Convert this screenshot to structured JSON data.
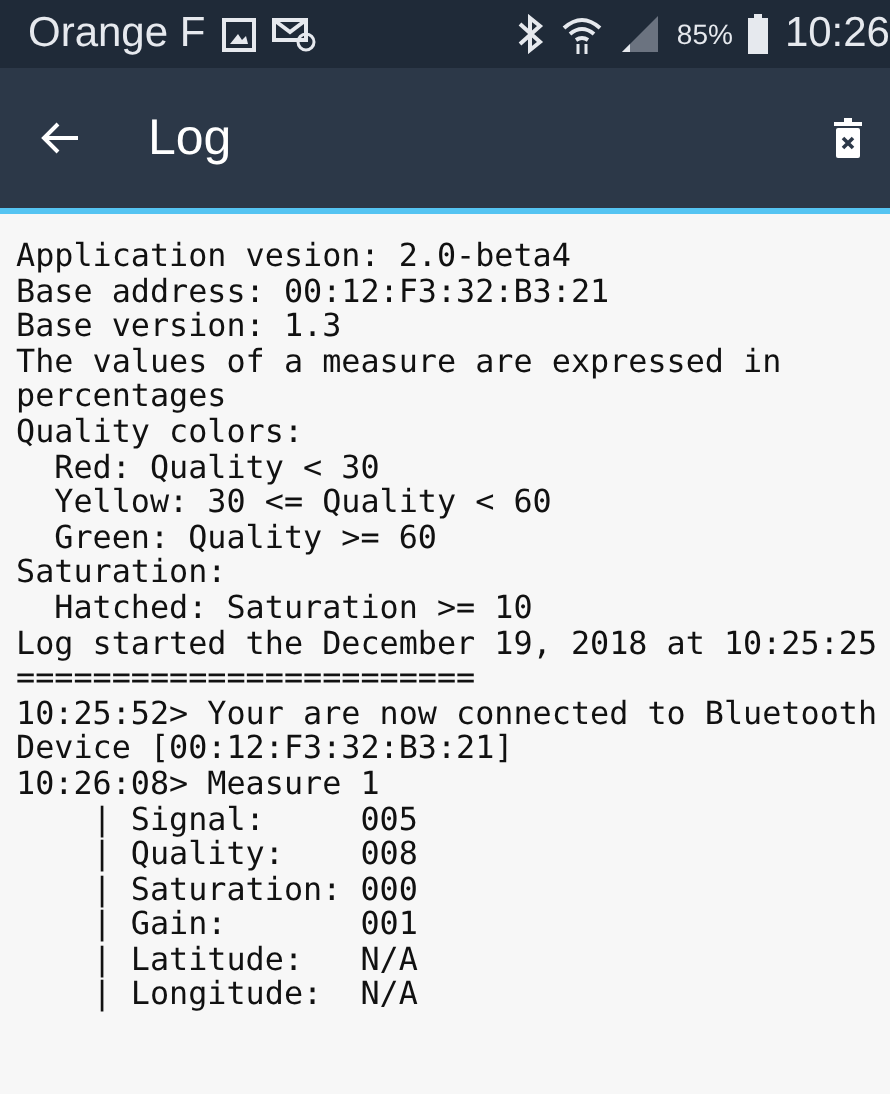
{
  "status_bar": {
    "carrier": "Orange F",
    "battery": "85%",
    "time": "10:26"
  },
  "app_bar": {
    "title": "Log"
  },
  "log": {
    "lines": [
      "Application vesion: 2.0-beta4",
      "Base address: 00:12:F3:32:B3:21",
      "Base version: 1.3",
      "The values of a measure are expressed in",
      "percentages",
      "Quality colors:",
      "  Red: Quality < 30",
      "  Yellow: 30 <= Quality < 60",
      "  Green: Quality >= 60",
      "Saturation:",
      "  Hatched: Saturation >= 10",
      "Log started the December 19, 2018 at 10:25:25",
      "========================",
      "10:25:52> Your are now connected to Bluetooth",
      "Device [00:12:F3:32:B3:21]",
      "10:26:08> Measure 1",
      "    | Signal:     005",
      "    | Quality:    008",
      "    | Saturation: 000",
      "    | Gain:       001",
      "    | Latitude:   N/A",
      "    | Longitude:  N/A"
    ]
  }
}
